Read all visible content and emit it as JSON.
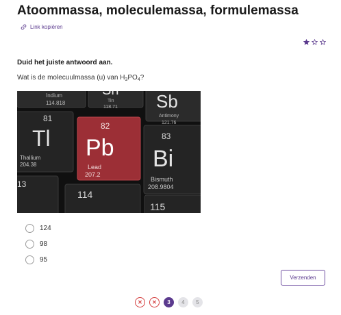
{
  "title": "Atoommassa, moleculemassa, formulemassa",
  "copy_link_label": "Link kopiëren",
  "difficulty": {
    "level": 1,
    "max": 3
  },
  "instruction": "Duid het juiste antwoord aan.",
  "question": {
    "prefix": "Wat is de molecuulmassa (u) van H",
    "sub1": "3",
    "mid": "PO",
    "sub2": "4",
    "suffix": "?"
  },
  "image": {
    "tiles": {
      "indium": {
        "name": "Indium",
        "mass": "114.818"
      },
      "tin": {
        "symbol": "Sn",
        "name": "Tin",
        "mass": "118.71"
      },
      "antimony": {
        "symbol": "Sb",
        "name": "Antimony",
        "mass": "121.76"
      },
      "thallium": {
        "number": "81",
        "symbol": "Tl",
        "name": "Thallium",
        "mass": "204.38"
      },
      "lead": {
        "number": "82",
        "symbol": "Pb",
        "name": "Lead",
        "mass": "207.2"
      },
      "bismuth": {
        "number": "83",
        "symbol": "Bi",
        "name": "Bismuth",
        "mass": "208.9804"
      },
      "row7_left": {
        "number": "13"
      },
      "row7_mid": {
        "number": "114"
      },
      "row7_right": {
        "number": "115"
      }
    }
  },
  "options": [
    {
      "label": "124"
    },
    {
      "label": "98"
    },
    {
      "label": "95"
    }
  ],
  "submit_label": "Verzenden",
  "pagination": [
    {
      "label": "✕",
      "state": "wrong"
    },
    {
      "label": "✕",
      "state": "wrong"
    },
    {
      "label": "3",
      "state": "current"
    },
    {
      "label": "4",
      "state": "upcoming"
    },
    {
      "label": "5",
      "state": "upcoming"
    }
  ],
  "colors": {
    "accent": "#5b3a8e",
    "error": "#d43f3f",
    "lead_tile": "#9c2f36"
  }
}
